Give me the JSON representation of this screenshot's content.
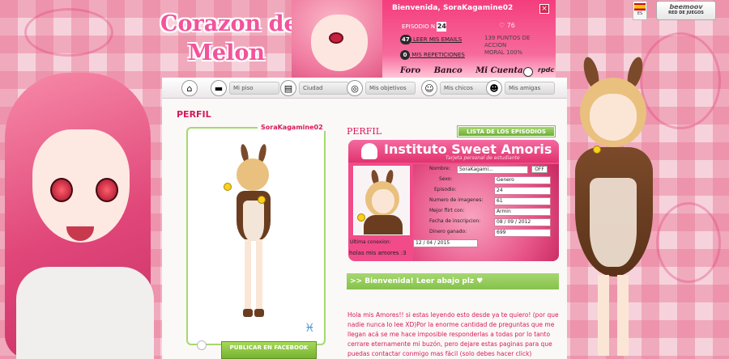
{
  "header": {
    "logo_line1": "Corazon de",
    "logo_line2": "Melon",
    "welcome": "Bienvenida, SoraKagamine02",
    "close": "×",
    "episode_label": "EPISODIO N",
    "episode_num": "24",
    "heart_count": "76",
    "emails_count": "47",
    "emails_label": "LEER MIS EMAILS",
    "points": "139 PUNTOS DE ACCION",
    "moral": "MORAL 100%",
    "reps_count": "0",
    "reps_label": "MIS REPETICIONES",
    "links": [
      "Foro",
      "Banco",
      "Mi Cuenta"
    ],
    "raku": "rpdc",
    "lang": "ES",
    "beemoov_label": "beemoov",
    "beemoov_sub": "RED DE JUEGOS"
  },
  "nav": [
    {
      "label": "",
      "icon": "home-icon"
    },
    {
      "label": "Mi piso",
      "icon": "sofa-icon"
    },
    {
      "label": "Ciudad",
      "icon": "city-icon"
    },
    {
      "label": "Mis objetivos",
      "icon": "target-icon"
    },
    {
      "label": "Mis chicos",
      "icon": "boy-icon"
    },
    {
      "label": "Mis amigas",
      "icon": "girl-icon"
    }
  ],
  "profile": {
    "section_title": "PERFIL",
    "name": "SoraKagamine02",
    "fb_button": "PUBLICAR EN FACEBOOK"
  },
  "card": {
    "subtitle_left": "PERFIL",
    "episodes_button": "LISTA DE LOS EPISODIOS",
    "title": "Instituto Sweet Amoris",
    "subtitle": "Tarjeta personal de estudiante",
    "off": "OFF",
    "rows": [
      {
        "k": "Nombre:",
        "v": "SoraKagami..."
      },
      {
        "k": "Sexo:",
        "v": "Genero"
      },
      {
        "k": "Episodio:",
        "v": "24"
      },
      {
        "k": "Numero de imagenes:",
        "v": "61"
      },
      {
        "k": "Mejor flirt con:",
        "v": "Armin"
      },
      {
        "k": "Fecha de inscripcion:",
        "v": "08 / 09 / 2012"
      },
      {
        "k": "Dinero ganado:",
        "v": "699"
      },
      {
        "k": "Ultima conexion:",
        "v": "12 / 04 / 2015"
      }
    ],
    "status": "holas mis amores :3"
  },
  "welcome_bar": ">> Bienvenida! Leer abajo plz ♥",
  "welcome_text": "Hola mis Amores!! si estas leyendo esto desde ya te quiero! (por que nadie nunca lo lee XD)Por la enorme cantidad de preguntas que me llegan acá se me hace imposible responderlas a todas por lo tanto cerrare eternamente mi buzón, pero dejare estas paginas para que puedas contactar conmigo mas fácil (solo debes hacer click)",
  "colors": {
    "accent": "#d81a5a",
    "green": "#86c24b",
    "pink": "#f14b89"
  }
}
